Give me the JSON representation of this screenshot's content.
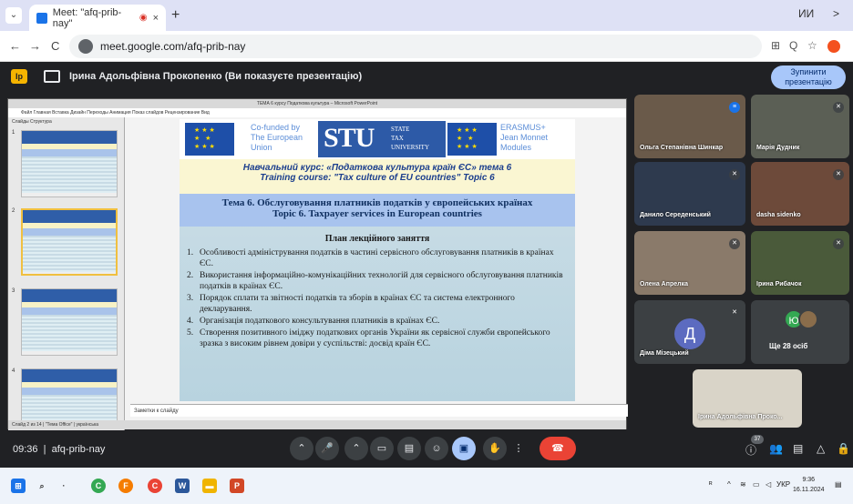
{
  "browser": {
    "tab_title": "Meet: \"afq-prib-nay\"",
    "tab_recording": "◉",
    "tab_close": "×",
    "new_tab": "+",
    "tab_menu": "⌄",
    "url": "meet.google.com/afq-prib-nay",
    "back": "←",
    "forward": "→",
    "reload": "C",
    "translate": "⊞",
    "zoom": "Q",
    "bookmark": "☆",
    "win_min": "ИИ",
    "win_more": ">"
  },
  "meet": {
    "presenting_text": "Ірина Адольфівна Прокопенко (Ви показуєте презентацію)",
    "stop_button": "Зупинити презентацію",
    "time": "09:36",
    "meeting_code": "afq-prib-nay",
    "participants_badge": "37",
    "participants": [
      {
        "name": "Ольга Степанівна Шинкар"
      },
      {
        "name": "Марія Дудник"
      },
      {
        "name": "Данило Середенський"
      },
      {
        "name": "dasha sidenko"
      },
      {
        "name": "Олена Апрелка"
      },
      {
        "name": "Ірина Рибачок"
      },
      {
        "name": "Діма Мізецький",
        "initial": "Д"
      },
      {
        "name": "Ще 28 осіб",
        "initial": "Ю"
      },
      {
        "name": "Ірина Адольфівна Проко..."
      }
    ]
  },
  "ppt": {
    "window_title": "ТЕМА 6 курсу Податкова культура – Microsoft PowerPoint",
    "ribbon": "Файл   Главная   Вставка   Дизайн   Переходы   Анимация   Показ слайдов   Рецензирование   Вид",
    "left_tabs": "Слайды   Структура",
    "notes_placeholder": "Заметки к слайду",
    "status": "Слайд 2 из 14  |  \"Тема Office\"  |  українська"
  },
  "slide": {
    "cofunded": [
      "Co-funded by",
      "The European",
      "Union"
    ],
    "stu_letters": "STU",
    "stu_text": [
      "STATE",
      "TAX",
      "UNIVERSITY"
    ],
    "erasmus": [
      "ERASMUS+",
      "Jean Monnet",
      "Modules"
    ],
    "course_ua": "Навчальний курс: «Податкова культура країн ЄС» тема 6",
    "course_en": "Training course: \"Tax culture of EU countries\" Topic 6",
    "topic_ua": "Тема 6. Обслуговування платників податків у європейських країнах",
    "topic_en": "Topic 6. Taxpayer services in European countries",
    "plan_title": "План лекційного заняття",
    "plan_items": [
      "Особливості адміністрування податків в частині сервісного обслуговування платників в країнах ЄС.",
      "Використання інформаційно-комунікаційних технологій для сервісного обслуговування платників податків в країнах ЄС.",
      "Порядок сплати та звітності податків та зборів в країнах ЄС та система електронного декларування.",
      "Організація податкового консультування платників в країнах ЄС.",
      "Створення позитивного іміджу податкових органів України як сервісної служби європейського зразка з високим рівнем довіри у суспільстві: досвід країн ЄС."
    ]
  },
  "taskbar": {
    "lang": "УКР",
    "clock_time": "9:36",
    "clock_date": "16.11.2024"
  }
}
